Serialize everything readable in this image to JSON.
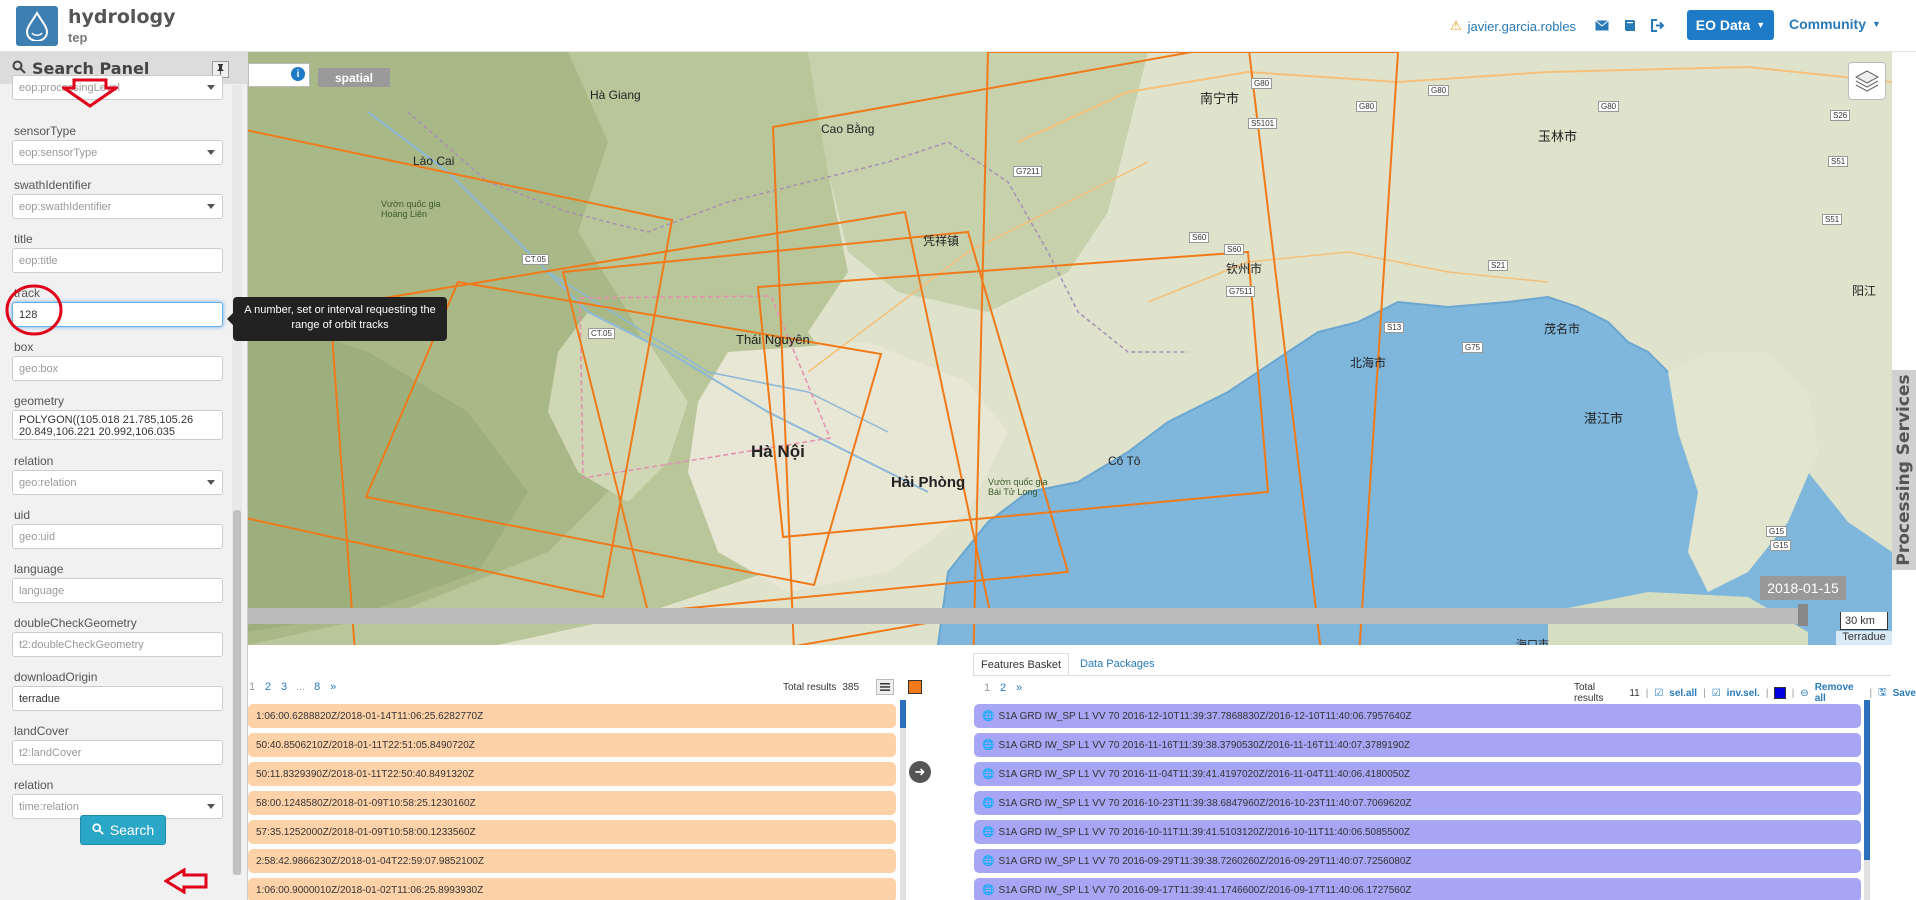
{
  "header": {
    "brand_name": "hydrology",
    "brand_sub": "tep",
    "user": "javier.garcia.robles",
    "eo_data_label": "EO Data",
    "community_label": "Community"
  },
  "panel": {
    "title": "Search Panel",
    "fields": [
      {
        "label": "",
        "placeholder": "eop:processingLevel",
        "type": "select"
      },
      {
        "label": "sensorType",
        "placeholder": "eop:sensorType",
        "type": "select"
      },
      {
        "label": "swathIdentifier",
        "placeholder": "eop:swathIdentifier",
        "type": "select"
      },
      {
        "label": "title",
        "placeholder": "eop:title",
        "type": "text"
      },
      {
        "label": "track",
        "value": "128",
        "type": "text"
      },
      {
        "label": "box",
        "placeholder": "geo:box",
        "type": "text"
      },
      {
        "label": "geometry",
        "value": "POLYGON((105.018 21.785,105.26 20.849,106.221 20.992,106.035",
        "type": "textarea"
      },
      {
        "label": "relation",
        "placeholder": "geo:relation",
        "type": "select"
      },
      {
        "label": "uid",
        "placeholder": "geo:uid",
        "type": "text"
      },
      {
        "label": "language",
        "placeholder": "language",
        "type": "text"
      },
      {
        "label": "doubleCheckGeometry",
        "placeholder": "t2:doubleCheckGeometry",
        "type": "text"
      },
      {
        "label": "downloadOrigin",
        "value": "terradue",
        "type": "text"
      },
      {
        "label": "landCover",
        "placeholder": "t2:landCover",
        "type": "text"
      },
      {
        "label": "relation",
        "placeholder": "time:relation",
        "type": "select"
      }
    ],
    "search_button": "Search",
    "tooltip": "A number, set or interval requesting the range of orbit tracks"
  },
  "map": {
    "spatial_tab": "spatial",
    "date": "2018-01-15",
    "scale": "30 km",
    "attribution": "Terradue",
    "processing_services": "Processing Services",
    "places": [
      {
        "name": "Hà Giang"
      },
      {
        "name": "Cao Bằng"
      },
      {
        "name": "Lào Cai"
      },
      {
        "name": "Thái Nguyên"
      },
      {
        "name": "Hà Nội"
      },
      {
        "name": "Hải Phòng"
      },
      {
        "name": "Cô Tô"
      },
      {
        "name": "南宁市"
      },
      {
        "name": "玉林市"
      },
      {
        "name": "钦州市"
      },
      {
        "name": "北海市"
      },
      {
        "name": "茂名市"
      },
      {
        "name": "湛江市"
      },
      {
        "name": "阳江"
      },
      {
        "name": "凭祥镇"
      },
      {
        "name": "海口市"
      },
      {
        "name": "Vườn quốc gia Hoàng Liên"
      },
      {
        "name": "Vườn quốc gia Bái Tử Long"
      }
    ],
    "roads": [
      "G80",
      "G80",
      "G80",
      "G80",
      "S26",
      "S51",
      "S51",
      "S5101",
      "G7211",
      "S60",
      "S60",
      "S21",
      "G7511",
      "S13",
      "G75",
      "G15",
      "G15",
      "CT.05",
      "CT.05"
    ]
  },
  "results": {
    "pages": [
      "1",
      "2",
      "3",
      "...",
      "8",
      "»"
    ],
    "total_label": "Total results",
    "total": "385",
    "rows": [
      "1:06:00.6288820Z/2018-01-14T11:06:25.6282770Z",
      "50:40.8506210Z/2018-01-11T22:51:05.8490720Z",
      "50:11.8329390Z/2018-01-11T22:50:40.8491320Z",
      "58:00.1248580Z/2018-01-09T10:58:25.1230160Z",
      "57:35.1252000Z/2018-01-09T10:58:00.1233560Z",
      "2:58:42.9866230Z/2018-01-04T22:59:07.9852100Z",
      "1:06:00.9000010Z/2018-01-02T11:06:25.8993930Z"
    ]
  },
  "basket": {
    "tab_features": "Features Basket",
    "tab_packages": "Data Packages",
    "pages": [
      "1",
      "2",
      "»"
    ],
    "total_label": "Total results",
    "total": "11",
    "sel_all": "sel.all",
    "inv_sel": "inv.sel.",
    "remove_all": "Remove all",
    "save": "Save",
    "rows": [
      "S1A GRD IW_SP L1 VV 70 2016-12-10T11:39:37.7868830Z/2016-12-10T11:40:06.7957640Z",
      "S1A GRD IW_SP L1 VV 70 2016-11-16T11:39:38.3790530Z/2016-11-16T11:40:07.3789190Z",
      "S1A GRD IW_SP L1 VV 70 2016-11-04T11:39:41.4197020Z/2016-11-04T11:40:06.4180050Z",
      "S1A GRD IW_SP L1 VV 70 2016-10-23T11:39:38.6847960Z/2016-10-23T11:40:07.7069620Z",
      "S1A GRD IW_SP L1 VV 70 2016-10-11T11:39:41.5103120Z/2016-10-11T11:40:06.5085500Z",
      "S1A GRD IW_SP L1 VV 70 2016-09-29T11:39:38.7260260Z/2016-09-29T11:40:07.7256080Z",
      "S1A GRD IW_SP L1 VV 70 2016-09-17T11:39:41.1746600Z/2016-09-17T11:40:06.1727560Z"
    ]
  },
  "colors": {
    "accent": "#1e7bc7",
    "footprint": "#f07a1a",
    "result_row": "#fdd2a8",
    "basket_row": "#a6a6f5",
    "annotation": "#e0001a"
  }
}
